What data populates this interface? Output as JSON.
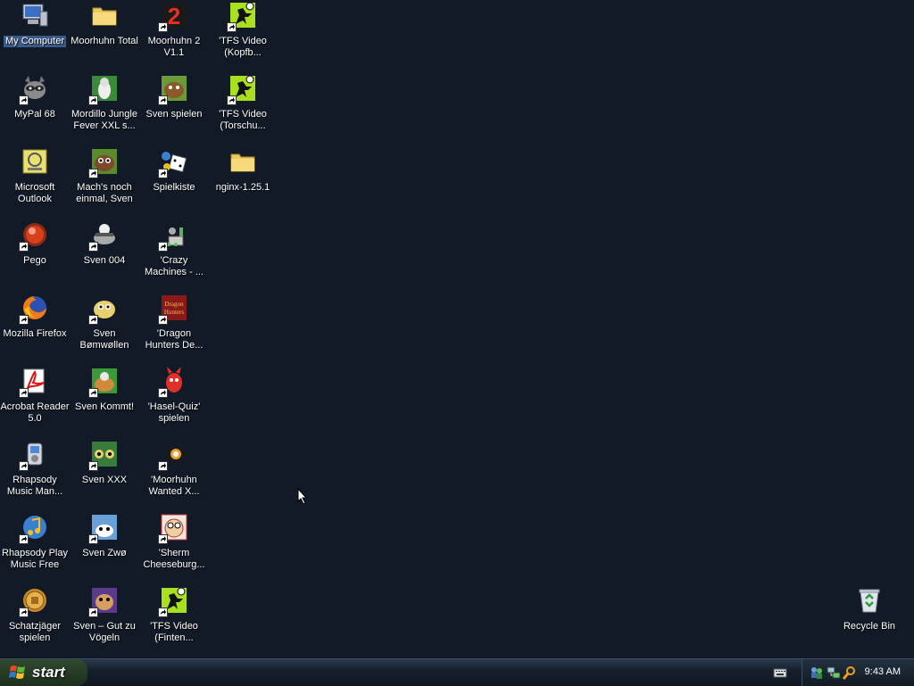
{
  "desktop": {
    "icons": [
      {
        "label": "My Computer",
        "icon": "computer-icon",
        "selected": true
      },
      {
        "label": "MyPal 68",
        "icon": "raccoon-icon"
      },
      {
        "label": "Microsoft Outlook",
        "icon": "outlook-icon"
      },
      {
        "label": "Pego",
        "icon": "pego-icon"
      },
      {
        "label": "Mozilla Firefox",
        "icon": "firefox-icon"
      },
      {
        "label": "Acrobat Reader 5.0",
        "icon": "acrobat-icon"
      },
      {
        "label": "Rhapsody Music Man...",
        "icon": "rhapsody-icon"
      },
      {
        "label": "Rhapsody Play Music Free",
        "icon": "music-note-icon"
      },
      {
        "label": "Schatzjäger spielen",
        "icon": "coin-icon"
      },
      {
        "label": "Moorhuhn Total",
        "icon": "folder-icon"
      },
      {
        "label": "Mordillo Jungle Fever XXL s...",
        "icon": "game-green-icon"
      },
      {
        "label": "Mach's noch einmal, Sven",
        "icon": "sven-icon"
      },
      {
        "label": "Sven 004",
        "icon": "sven-004-icon"
      },
      {
        "label": "Sven Bømwøllen",
        "icon": "sven-sheep-icon"
      },
      {
        "label": "Sven Kommt!",
        "icon": "sven-kommt-icon"
      },
      {
        "label": "Sven XXX",
        "icon": "sven-xxx-icon"
      },
      {
        "label": "Sven Zwø",
        "icon": "sven-zwo-icon"
      },
      {
        "label": "Sven – Gut zu Vögeln",
        "icon": "sven-gut-icon"
      },
      {
        "label": "Moorhuhn 2 V1.1",
        "icon": "moorhuhn-2-icon"
      },
      {
        "label": "Sven spielen",
        "icon": "sven-play-icon"
      },
      {
        "label": "Spielkiste",
        "icon": "dice-icon"
      },
      {
        "label": "'Crazy Machines - ...",
        "icon": "crazy-machines-icon"
      },
      {
        "label": "'Dragon Hunters De...",
        "icon": "dragon-hunters-icon"
      },
      {
        "label": "'Hasel-Quiz' spielen",
        "icon": "hasel-quiz-icon"
      },
      {
        "label": "'Moorhuhn Wanted X...",
        "icon": "moorhuhn-wanted-icon"
      },
      {
        "label": "'Sherm Cheeseburg...",
        "icon": "sherm-icon"
      },
      {
        "label": "'TFS Video (Finten...",
        "icon": "tfs-video-icon"
      },
      {
        "label": "'TFS Video (Kopfb...",
        "icon": "tfs-video-icon"
      },
      {
        "label": "'TFS Video (Torschu...",
        "icon": "tfs-video-icon"
      },
      {
        "label": "nginx-1.25.1",
        "icon": "folder-icon"
      },
      {
        "label": "Recycle Bin",
        "icon": "recycle-bin-icon"
      }
    ]
  },
  "taskbar": {
    "start_label": "start",
    "clock": "9:43 AM",
    "tray_icons": [
      "network-users-icon",
      "network-icon",
      "search-icon"
    ]
  },
  "colors": {
    "desktop_bg": "#111a26",
    "taskbar_bg": "#16202d"
  }
}
